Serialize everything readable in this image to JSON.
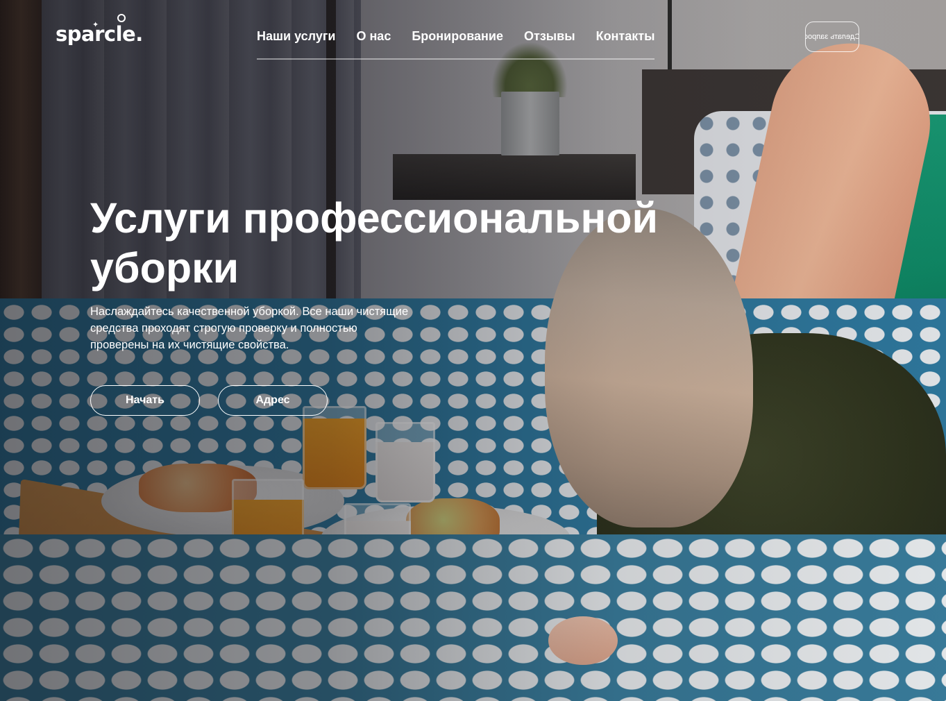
{
  "logo": {
    "text": "sparcle."
  },
  "nav": {
    "items": [
      {
        "label": "Наши услуги"
      },
      {
        "label": "О нас"
      },
      {
        "label": "Бронирование"
      },
      {
        "label": "Отзывы"
      },
      {
        "label": "Контакты"
      }
    ],
    "cta_label": "Сделать запрос"
  },
  "hero": {
    "title_line1": "Услуги профессиональной",
    "title_line2": "уборки",
    "subtitle": "Наслаждайтесь качественной уборкой. Все наши чистящие средства проходят строгую проверку и полностью проверены на их чистящие свойства.",
    "buttons": {
      "start": "Начать",
      "address": "Адрес"
    }
  },
  "colors": {
    "text": "#ffffff",
    "accent_green": "#0f8a66",
    "bedding_blue": "#2f7aa0"
  },
  "icons": {
    "logo_sparkle": "sparkle-icon",
    "logo_ring": "ring-icon"
  }
}
